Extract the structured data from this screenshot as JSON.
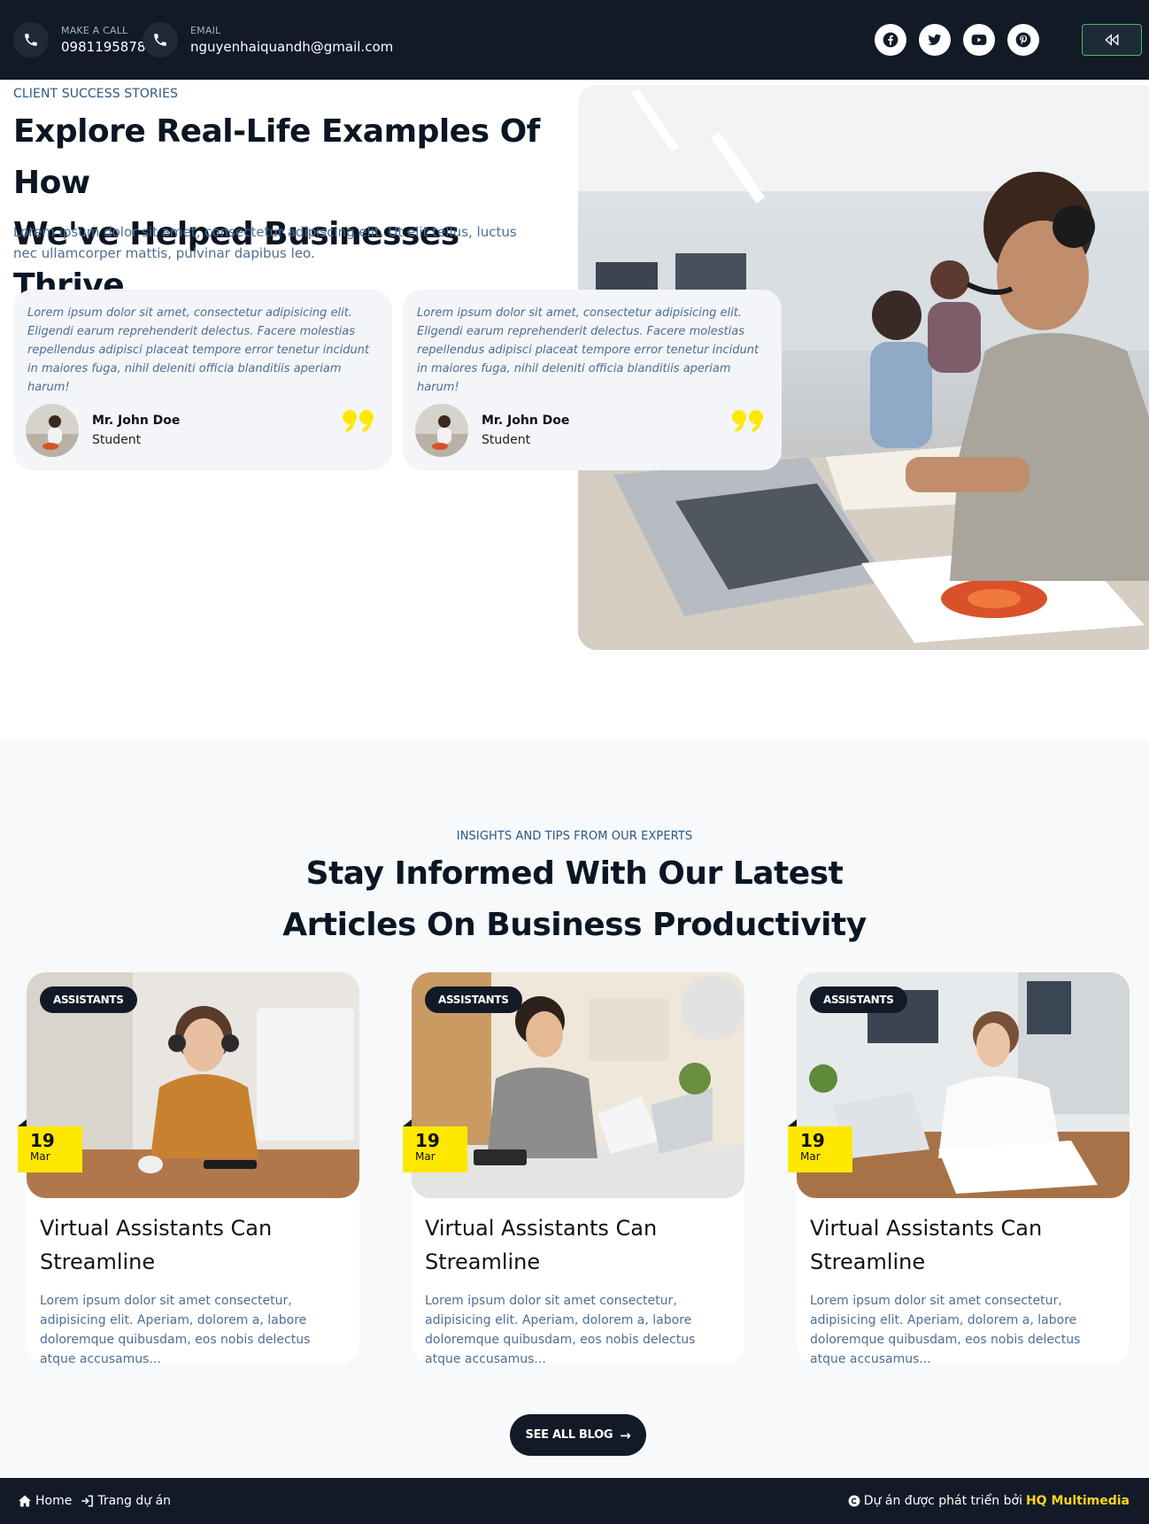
{
  "header": {
    "phone": {
      "label": "MAKE A CALL",
      "value": "0981195878",
      "icon": "phone-icon"
    },
    "email": {
      "label": "EMAIL",
      "value": "nguyenhaiquandh@gmail.com",
      "icon": "phone-icon"
    },
    "socials": [
      {
        "name": "facebook-icon"
      },
      {
        "name": "twitter-icon"
      },
      {
        "name": "youtube-icon"
      },
      {
        "name": "pinterest-icon"
      }
    ],
    "back_icon": "rewind-icon",
    "back_border_color": "#3fbf5a"
  },
  "hero": {
    "kicker": "CLIENT SUCCESS STORIES",
    "title_line1": "Explore Real-Life Examples Of How",
    "title_line2": "We've Helped Businesses Thrive",
    "description": "Lorem ipsum dolor sit amet, consectetur adipiscing elit. Ut elit tellus, luctus nec ullamcorper mattis, pulvinar dapibus leo.",
    "testimonials": [
      {
        "text": "Lorem ipsum dolor sit amet, consectetur adipisicing elit. Eligendi earum reprehenderit delectus. Facere molestias repellendus adipisci placeat tempore error tenetur incidunt in maiores fuga, nihil deleniti officia blanditiis aperiam harum!",
        "name": "Mr. John Doe",
        "role": "Student"
      },
      {
        "text": "Lorem ipsum dolor sit amet, consectetur adipisicing elit. Eligendi earum reprehenderit delectus. Facere molestias repellendus adipisci placeat tempore error tenetur incidunt in maiores fuga, nihil deleniti officia blanditiis aperiam harum!",
        "name": "Mr. John Doe",
        "role": "Student"
      }
    ]
  },
  "blog": {
    "kicker": "INSIGHTS AND TIPS FROM OUR EXPERTS",
    "title_line1": "Stay Informed With Our Latest",
    "title_line2": "Articles On Business Productivity",
    "posts": [
      {
        "tag": "ASSISTANTS",
        "day": "19",
        "month": "Mar",
        "title": "Virtual Assistants Can Streamline",
        "excerpt": "Lorem ipsum dolor sit amet consectetur, adipisicing elit. Aperiam, dolorem a, labore doloremque quibusdam, eos nobis delectus atque accusamus..."
      },
      {
        "tag": "ASSISTANTS",
        "day": "19",
        "month": "Mar",
        "title": "Virtual Assistants Can Streamline",
        "excerpt": "Lorem ipsum dolor sit amet consectetur, adipisicing elit. Aperiam, dolorem a, labore doloremque quibusdam, eos nobis delectus atque accusamus..."
      },
      {
        "tag": "ASSISTANTS",
        "day": "19",
        "month": "Mar",
        "title": "Virtual Assistants Can Streamline",
        "excerpt": "Lorem ipsum dolor sit amet consectetur, adipisicing elit. Aperiam, dolorem a, labore doloremque quibusdam, eos nobis delectus atque accusamus..."
      }
    ],
    "see_all_label": "SEE ALL BLOG"
  },
  "footer": {
    "home_label": "Home",
    "project_label": "Trang dự án",
    "credit_prefix": "Dự án được phát triển bởi",
    "credit_brand": "HQ Multimedia"
  },
  "colors": {
    "dark": "#111a26",
    "accent_yellow": "#ffe800",
    "kicker_blue": "#2b5883",
    "body_blue": "#4e6e93"
  }
}
